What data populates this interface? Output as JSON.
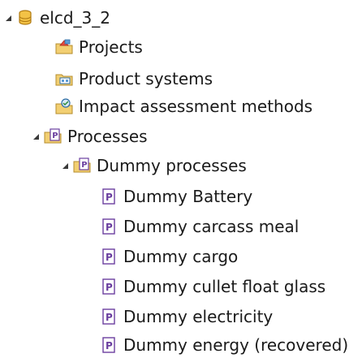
{
  "tree": {
    "root": {
      "label": "elcd_3_2",
      "icon": "database-icon",
      "expanded": true,
      "children": [
        {
          "label": "Projects",
          "icon": "projects-folder-icon"
        },
        {
          "label": "Product systems",
          "icon": "product-systems-folder-icon"
        },
        {
          "label": "Impact assessment methods",
          "icon": "impact-methods-folder-icon"
        },
        {
          "label": "Processes",
          "icon": "processes-folder-icon",
          "expanded": true,
          "children": [
            {
              "label": "Dummy processes",
              "icon": "processes-category-icon",
              "expanded": true,
              "children": [
                {
                  "label": "Dummy Battery",
                  "icon": "process-icon"
                },
                {
                  "label": "Dummy carcass meal",
                  "icon": "process-icon"
                },
                {
                  "label": "Dummy cargo",
                  "icon": "process-icon"
                },
                {
                  "label": "Dummy cullet float glass",
                  "icon": "process-icon"
                },
                {
                  "label": "Dummy electricity",
                  "icon": "process-icon"
                },
                {
                  "label": "Dummy energy (recovered)",
                  "icon": "process-icon"
                }
              ]
            }
          ]
        }
      ]
    }
  }
}
